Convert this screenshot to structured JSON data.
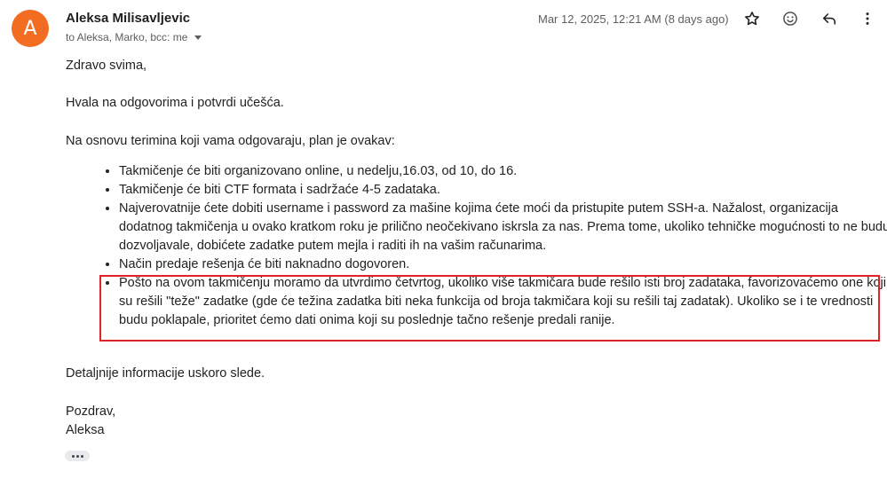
{
  "header": {
    "avatar_letter": "A",
    "avatar_color": "#f26d21",
    "sender_name": "Aleksa Milisavljevic",
    "recipients": "to Aleksa, Marko, bcc: me",
    "timestamp": "Mar 12, 2025, 12:21 AM (8 days ago)",
    "icons": [
      "star-icon",
      "emoji-icon",
      "reply-icon",
      "more-vert-icon"
    ]
  },
  "body": {
    "greeting": "Zdravo svima,",
    "thanks": "Hvala na odgovorima i potvrdi učešća.",
    "intro": "Na osnovu terimina koji vama odgovaraju, plan je ovakav:",
    "plan_items": [
      "Takmičenje će biti organizovano online, u nedelju,16.03, od 10, do 16.",
      "Takmičenje će biti CTF formata i sadržaće 4-5 zadataka.",
      "Najverovatnije ćete dobiti username i password za mašine kojima ćete moći da pristupite putem SSH-a. Nažalost, organizacija dodatnog takmičenja u ovako kratkom roku je prilično neočekivano iskrsla za nas. Prema tome, ukoliko tehničke mogućnosti to ne budu dozvoljavale, dobićete zadatke putem mejla i raditi ih na vašim računarima.",
      "Način predaje rešenja će biti naknadno dogovoren.",
      "Pošto na ovom takmičenju moramo da utvrdimo četvrtog, ukoliko više takmičara bude rešilo isti broj zadataka, favorizovaćemo one koji su rešili \"teže\" zadatke (gde će težina zadatka biti neka funkcija od broja takmičara koji su rešili taj zadatak). Ukoliko se i te vrednosti budu poklapale, prioritet ćemo dati onima koji su poslednje tačno rešenje predali ranije."
    ],
    "details": "Detaljnije informacije uskoro slede.",
    "closing": "Pozdrav,",
    "signature": "Aleksa"
  },
  "highlight_color": "#e02424"
}
